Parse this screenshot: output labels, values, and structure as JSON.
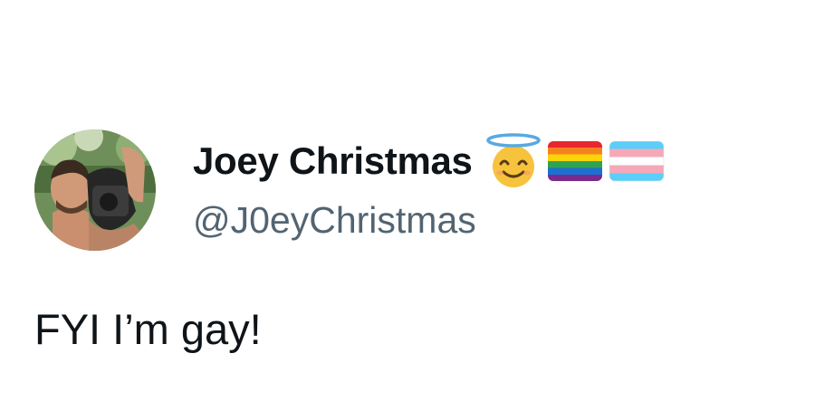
{
  "author": {
    "display_name": "Joey Christmas",
    "handle": "@J0eyChristmas",
    "badges": [
      "smiling-face-with-halo-emoji",
      "rainbow-flag-emoji",
      "transgender-flag-emoji"
    ]
  },
  "tweet": {
    "text": "FYI I’m gay!"
  },
  "colors": {
    "name": "#0f1419",
    "handle": "#536471",
    "text": "#0f1419",
    "background": "#ffffff"
  }
}
